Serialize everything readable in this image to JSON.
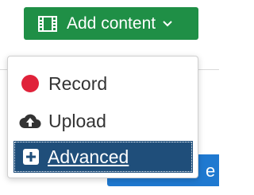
{
  "add_content_button": {
    "icon": "film-icon",
    "label": "Add content",
    "chevron_icon": "chevron-down-icon",
    "color": "#1f8f46"
  },
  "menu": {
    "items": [
      {
        "label": "Record",
        "icon": "record-dot-icon",
        "icon_color": "#e0223a"
      },
      {
        "label": "Upload",
        "icon": "cloud-upload-icon",
        "icon_color": "#333333"
      },
      {
        "label": "Advanced",
        "icon": "plus-square-icon",
        "highlight_color": "#1f4e7a"
      }
    ]
  },
  "background_button": {
    "partial_label": "e n",
    "color": "#1f79d0"
  }
}
